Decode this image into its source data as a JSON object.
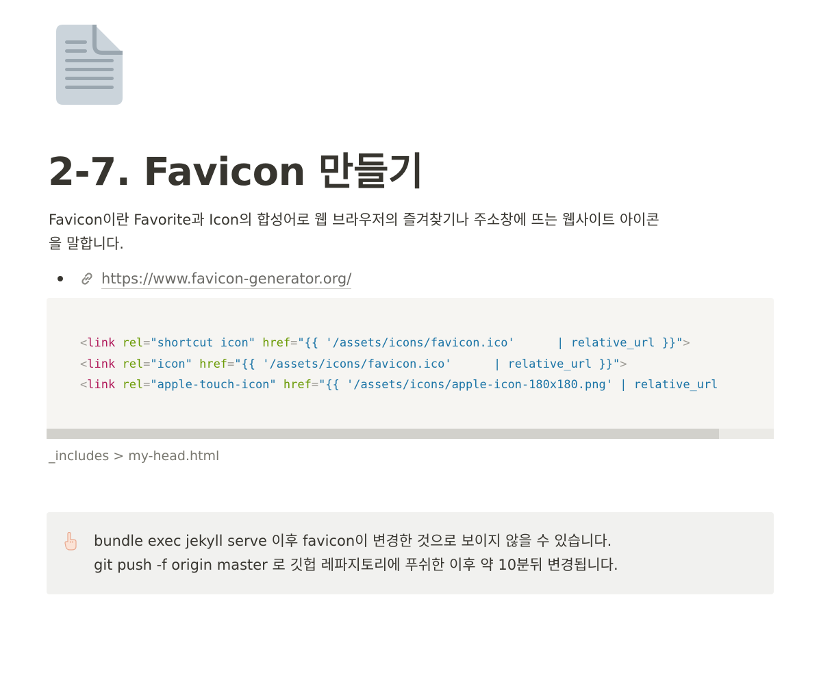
{
  "page": {
    "icon": "document-icon",
    "title": "2-7. Favicon 만들기",
    "intro_line1": "Favicon이란 Favorite과 Icon의 합성어로 웹 브라우저의 즐겨찾기나 주소창에 뜨는 웹사이트 아이콘",
    "intro_line2": "을 말합니다."
  },
  "bullet": {
    "icon": "link-icon",
    "link_text": "https://www.favicon-generator.org/"
  },
  "code_block": {
    "lines": [
      [
        {
          "t": "<",
          "c": "punct"
        },
        {
          "t": "link",
          "c": "tag"
        },
        {
          "t": " ",
          "c": "plain"
        },
        {
          "t": "rel",
          "c": "attr"
        },
        {
          "t": "=",
          "c": "punct"
        },
        {
          "t": "\"shortcut icon\"",
          "c": "str"
        },
        {
          "t": " ",
          "c": "plain"
        },
        {
          "t": "href",
          "c": "attr"
        },
        {
          "t": "=",
          "c": "punct"
        },
        {
          "t": "\"{{ '/assets/icons/favicon.ico'      | relative_url }}\"",
          "c": "str"
        },
        {
          "t": ">",
          "c": "punct"
        }
      ],
      [
        {
          "t": "<",
          "c": "punct"
        },
        {
          "t": "link",
          "c": "tag"
        },
        {
          "t": " ",
          "c": "plain"
        },
        {
          "t": "rel",
          "c": "attr"
        },
        {
          "t": "=",
          "c": "punct"
        },
        {
          "t": "\"icon\"",
          "c": "str"
        },
        {
          "t": " ",
          "c": "plain"
        },
        {
          "t": "href",
          "c": "attr"
        },
        {
          "t": "=",
          "c": "punct"
        },
        {
          "t": "\"{{ '/assets/icons/favicon.ico'      | relative_url }}\"",
          "c": "str"
        },
        {
          "t": ">",
          "c": "punct"
        }
      ],
      [
        {
          "t": "<",
          "c": "punct"
        },
        {
          "t": "link",
          "c": "tag"
        },
        {
          "t": " ",
          "c": "plain"
        },
        {
          "t": "rel",
          "c": "attr"
        },
        {
          "t": "=",
          "c": "punct"
        },
        {
          "t": "\"apple-touch-icon\"",
          "c": "str"
        },
        {
          "t": " ",
          "c": "plain"
        },
        {
          "t": "href",
          "c": "attr"
        },
        {
          "t": "=",
          "c": "punct"
        },
        {
          "t": "\"{{ '/assets/icons/apple-icon-180x180.png' | relative_url",
          "c": "str"
        }
      ]
    ],
    "caption": "_includes > my-head.html"
  },
  "callout": {
    "icon": "pointing-up-hand-icon",
    "line1": "bundle exec jekyll serve 이후 favicon이 변경한 것으로 보이지 않을 수 있습니다.",
    "line2": "git push -f origin master 로 깃헙 레파지토리에 푸쉬한 이후 약 10분뒤 변경됩니다."
  }
}
